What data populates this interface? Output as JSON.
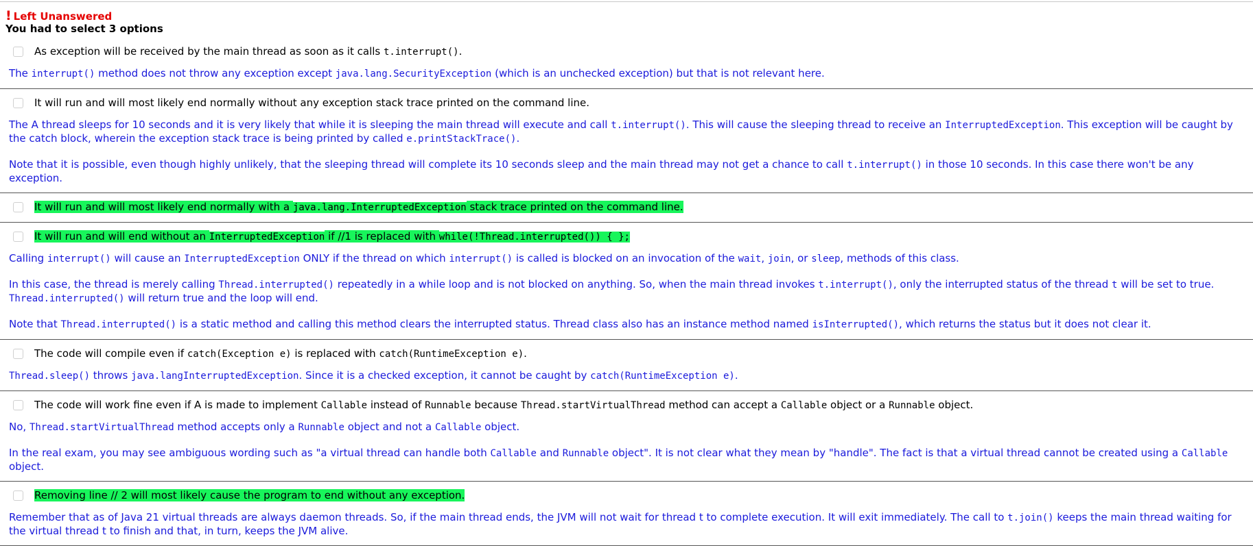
{
  "header": {
    "status_icon": "!",
    "status_text": "Left Unanswered",
    "requirement": "You had to select 3 options"
  },
  "colors": {
    "status": "#e50000",
    "explanation": "#1a1adb",
    "correct_highlight": "#18f55b"
  },
  "options": [
    {
      "correct": false,
      "text": [
        {
          "t": "As exception will be received by the main thread as soon as it calls "
        },
        {
          "t": "t.interrupt()",
          "code": true
        },
        {
          "t": "."
        }
      ],
      "explanation": [
        [
          {
            "t": "The ",
            "code": false
          },
          {
            "t": "interrupt()",
            "code": true
          },
          {
            "t": " method does not throw any exception except "
          },
          {
            "t": "java.lang.SecurityException",
            "code": true
          },
          {
            "t": " (which is an unchecked exception) but that is not relevant here."
          }
        ]
      ]
    },
    {
      "correct": false,
      "text": [
        {
          "t": "It will run and will most likely end normally without any exception stack trace printed on the command line."
        }
      ],
      "explanation": [
        [
          {
            "t": "The A thread sleeps for 10 seconds and it is very likely that while it is sleeping the main thread will execute and call "
          },
          {
            "t": "t.interrupt()",
            "code": true
          },
          {
            "t": ". This will cause the sleeping thread to receive an "
          },
          {
            "t": "InterruptedException",
            "code": true
          },
          {
            "t": ". This exception will be caught by the catch block, wherein the exception stack trace is being printed by called "
          },
          {
            "t": "e.printStackTrace()",
            "code": true
          },
          {
            "t": "."
          }
        ],
        [
          {
            "t": "Note that it is possible, even though highly unlikely, that the sleeping thread will complete its 10 seconds sleep and the main thread may not get a chance to call "
          },
          {
            "t": "t.interrupt()",
            "code": true
          },
          {
            "t": " in those 10 seconds. In this case there won't be any exception."
          }
        ]
      ]
    },
    {
      "correct": true,
      "text": [
        {
          "t": "It will run and will most likely end normally with a "
        },
        {
          "t": "java.lang.InterruptedException",
          "code": true
        },
        {
          "t": " stack trace printed on the command line."
        }
      ],
      "explanation": []
    },
    {
      "correct": true,
      "text": [
        {
          "t": "It will run and will end without an "
        },
        {
          "t": "InterruptedException",
          "code": true
        },
        {
          "t": " if //1 is replaced with "
        },
        {
          "t": "while(!Thread.interrupted()) { };",
          "code": true
        }
      ],
      "explanation": [
        [
          {
            "t": "Calling "
          },
          {
            "t": "interrupt()",
            "code": true
          },
          {
            "t": " will cause an "
          },
          {
            "t": "InterruptedException",
            "code": true
          },
          {
            "t": " ONLY if the thread on which "
          },
          {
            "t": "interrupt()",
            "code": true
          },
          {
            "t": " is called is blocked on an invocation of the "
          },
          {
            "t": "wait",
            "code": true
          },
          {
            "t": ", "
          },
          {
            "t": "join",
            "code": true
          },
          {
            "t": ", or "
          },
          {
            "t": "sleep",
            "code": true
          },
          {
            "t": ", methods of this class."
          }
        ],
        [
          {
            "t": "In this case, the thread is merely calling "
          },
          {
            "t": "Thread.interrupted()",
            "code": true
          },
          {
            "t": " repeatedly in a while loop and is not blocked on anything. So, when the main thread invokes "
          },
          {
            "t": "t.interrupt()",
            "code": true
          },
          {
            "t": ", only the interrupted status of the thread "
          },
          {
            "t": "t",
            "code": true
          },
          {
            "t": " will be set to true. "
          },
          {
            "t": "Thread.interrupted()",
            "code": true,
            "br": true
          },
          {
            "t": " will return true and the loop will end."
          }
        ],
        [
          {
            "t": "Note that "
          },
          {
            "t": "Thread.interrupted()",
            "code": true
          },
          {
            "t": " is a static method and calling this method clears the interrupted status. Thread class also has an instance method named "
          },
          {
            "t": "isInterrupted()",
            "code": true
          },
          {
            "t": ", which returns the status but it does not clear it."
          }
        ]
      ]
    },
    {
      "correct": false,
      "text": [
        {
          "t": "The code will compile even if "
        },
        {
          "t": "catch(Exception e)",
          "code": true
        },
        {
          "t": " is replaced with "
        },
        {
          "t": "catch(RuntimeException e)",
          "code": true
        },
        {
          "t": "."
        }
      ],
      "explanation": [
        [
          {
            "t": "Thread.sleep()",
            "code": true
          },
          {
            "t": " throws "
          },
          {
            "t": "java.langInterruptedException",
            "code": true
          },
          {
            "t": ". Since it is a checked exception, it cannot be caught by "
          },
          {
            "t": "catch(RuntimeException e)",
            "code": true
          },
          {
            "t": "."
          }
        ]
      ]
    },
    {
      "correct": false,
      "text": [
        {
          "t": "The code will work fine even if A is made to implement "
        },
        {
          "t": "Callable",
          "code": true
        },
        {
          "t": " instead of "
        },
        {
          "t": "Runnable",
          "code": true
        },
        {
          "t": " because "
        },
        {
          "t": "Thread.startVirtualThread",
          "code": true
        },
        {
          "t": " method can accept a "
        },
        {
          "t": "Callable",
          "code": true
        },
        {
          "t": " object or a "
        },
        {
          "t": "Runnable",
          "code": true
        },
        {
          "t": " object."
        }
      ],
      "explanation": [
        [
          {
            "t": "No,  "
          },
          {
            "t": "Thread.startVirtualThread",
            "code": true
          },
          {
            "t": " method accepts only a "
          },
          {
            "t": "Runnable",
            "code": true
          },
          {
            "t": " object and not a "
          },
          {
            "t": "Callable",
            "code": true
          },
          {
            "t": " object."
          }
        ],
        [
          {
            "t": "In the real exam, you may see ambiguous wording such as \"a virtual thread can handle both "
          },
          {
            "t": "Callable",
            "code": true
          },
          {
            "t": " and "
          },
          {
            "t": "Runnable",
            "code": true
          },
          {
            "t": " object\". It is not clear what they mean by \"handle\". The fact is that a virtual thread cannot be created using a "
          },
          {
            "t": "Callable",
            "code": true
          },
          {
            "t": " object."
          }
        ]
      ]
    },
    {
      "correct": true,
      "text": [
        {
          "t": "Removing line // 2 will most likely cause the program to end without any exception."
        }
      ],
      "explanation": [
        [
          {
            "t": "Remember that as of Java 21 virtual threads are always daemon threads. So, if the main thread ends, the JVM will not wait for thread t to complete execution. It will exit immediately. The call to "
          },
          {
            "t": "t.join()",
            "code": true
          },
          {
            "t": " keeps the main thread waiting for the virtual thread t to finish and that, in turn, keeps the JVM alive."
          }
        ]
      ]
    }
  ]
}
